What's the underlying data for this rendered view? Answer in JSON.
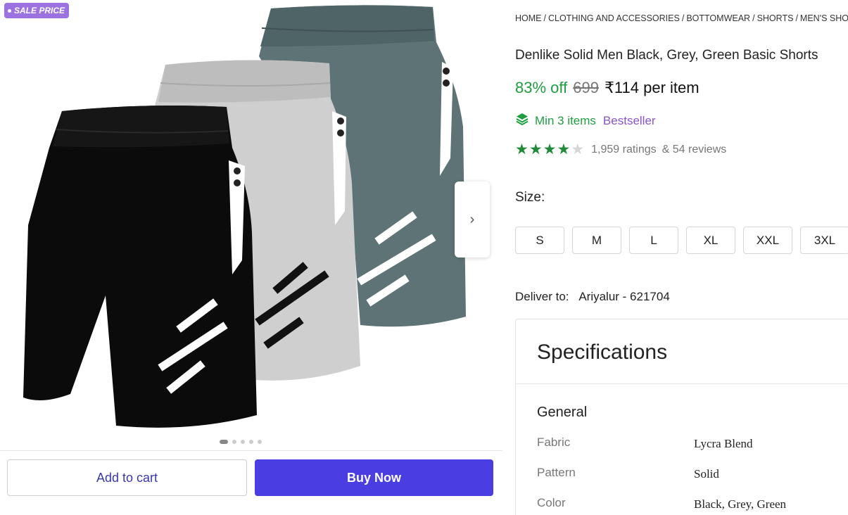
{
  "gallery": {
    "sale_badge": "SALE PRICE",
    "image_count": 5,
    "active_image": 1,
    "product_colors": [
      "#0b0b0b",
      "#cfcfcf",
      "#5d7375"
    ]
  },
  "actions": {
    "add_to_cart": "Add to cart",
    "buy_now": "Buy Now"
  },
  "product": {
    "breadcrumb": [
      "HOME",
      "CLOTHING AND ACCESSORIES",
      "BOTTOMWEAR",
      "SHORTS",
      "MEN'S SHO"
    ],
    "title": "Denlike Solid Men Black, Grey, Green Basic Shorts",
    "discount": "83% off",
    "mrp": "699",
    "price": "₹114 per item",
    "min_items": "Min 3 items",
    "bestseller": "Bestseller",
    "rating_value": 4,
    "rating_max": 5,
    "ratings": "1,959 ratings",
    "reviews": "& 54 reviews",
    "size_label": "Size:",
    "sizes": [
      "S",
      "M",
      "L",
      "XL",
      "XXL",
      "3XL"
    ],
    "deliver_label": "Deliver to:",
    "deliver_location": "Ariyalur - 621704"
  },
  "specifications": {
    "title": "Specifications",
    "group": "General",
    "rows": [
      {
        "key": "Fabric",
        "value": "Lycra Blend"
      },
      {
        "key": "Pattern",
        "value": "Solid"
      },
      {
        "key": "Color",
        "value": "Black, Grey, Green"
      }
    ]
  },
  "colors": {
    "accent": "#4a3ee3",
    "discount_green": "#1e9e3f",
    "bestseller_purple": "#8a55c8",
    "sale_badge": "#9b72e0"
  }
}
